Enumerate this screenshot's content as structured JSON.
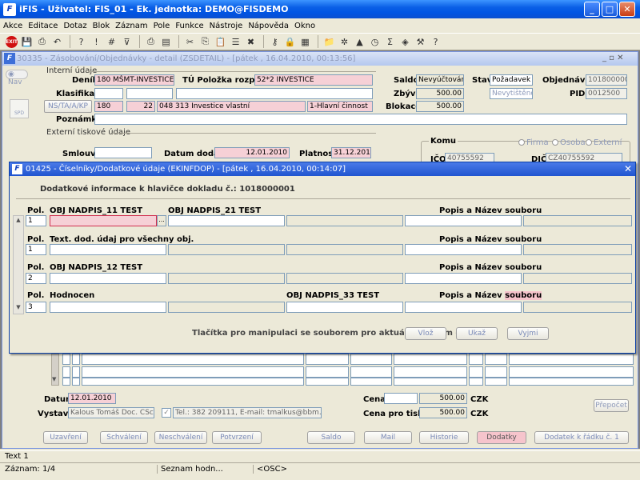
{
  "app": {
    "title": "iFIS - Uživatel: FIS_01 - Ek. jednotka: DEMO@FISDEMO",
    "logo": "F"
  },
  "menu": [
    "Akce",
    "Editace",
    "Dotaz",
    "Blok",
    "Záznam",
    "Pole",
    "Funkce",
    "Nástroje",
    "Nápověda",
    "Okno"
  ],
  "toolbar": {
    "exit_label": "EXIT"
  },
  "child": {
    "title": "30335 - Zásobování/Objednávky - detail (ZSDETAIL) - [pátek , 16.04.2010, 00:13:56]"
  },
  "nav": {
    "label": "Nav",
    "spd": "SPD"
  },
  "sections": {
    "internal": "Interní údaje",
    "external": "Externí tiskové údaje"
  },
  "form": {
    "denik_label": "Deník",
    "denik_value": "180 MŠMT-INVESTICE",
    "tu_label": "TÚ Položka rozpočtu",
    "tu_value": "52*2 INVESTICE",
    "klasifikace_label": "Klasifikace",
    "ns_label": "NS/TA/A/KP",
    "ns_v1": "180",
    "ns_v2": "22",
    "ns_v3": "048 313 Investice vlastní",
    "ns_v4": "1-Hlavní činnost",
    "poznamka_label": "Poznámka",
    "saldo_label": "Saldo",
    "saldo_value": "Nevyúčtováno",
    "zbyva_label": "Zbývá",
    "zbyva_value": "500.00",
    "blokace_label": "Blokace",
    "blokace_value": "500.00",
    "stav_label": "Stav",
    "stav_value": "Požadavek",
    "stav_value2": "Nevytištěno",
    "obj_label": "Objednávka",
    "obj_value": "1018000001",
    "pid_label": "PID",
    "pid_value": "0012500",
    "smlouva_label": "Smlouva",
    "datum_dodani_label": "Datum dodání",
    "datum_dodani_value": "12.01.2010",
    "platnost_label": "Platnost",
    "platnost_value": "31.12.2010",
    "komu_label": "Komu",
    "radio_firma": "Firma",
    "radio_osoba": "Osoba",
    "radio_externi": "Externí",
    "ico_label": "IČO",
    "ico_value": "40755592",
    "dic_label": "DIČ",
    "dic_value": "CZ40755592"
  },
  "dialog": {
    "title": "01425 - Číselníky/Dodatkové údaje (EKINFDOP) - [pátek , 16.04.2010, 00:14:07]",
    "header": "Dodatkové informace k hlavičce dokladu č.: 1018000001",
    "pol_label": "Pol.",
    "popis_label": "Popis a Název souboru",
    "popis_part1": "Popis a Název",
    "popis_part2": "souboru",
    "rows": [
      {
        "num": "1",
        "label1": "OBJ NADPIS_11 TEST",
        "label2": "OBJ NADPIS_21 TEST"
      },
      {
        "num": "1",
        "label1": "Text. dod. údaj pro všechny obj.",
        "label2": ""
      },
      {
        "num": "2",
        "label1": "OBJ NADPIS_12 TEST",
        "label2": ""
      },
      {
        "num": "3",
        "label1": "Hodnocen",
        "label2": "OBJ NADPIS_33 TEST"
      }
    ],
    "footer_text": "Tlačítka pro manipulaci se souborem pro aktuální záznam -->",
    "btn_vloz": "Vlož",
    "btn_ukaz": "Ukaž",
    "btn_vyjmi": "Vyjmi",
    "ellipsis": "..."
  },
  "bottom": {
    "datum_label": "Datum",
    "datum_value": "12.01.2010",
    "vystavil_label": "Vystavil",
    "vystavil_value": "Kalous Tomáš Doc. CSc.",
    "tel_value": "Tel.: 382 209111, E-mail: tmalkus@bbm.cz",
    "cena_label": "Cena",
    "cena_value": "500.00",
    "cena_currency": "CZK",
    "cena_tisk_label": "Cena pro tisk",
    "cena_tisk_value": "500.00",
    "cena_tisk_currency": "CZK",
    "prepocet": "Přepočet"
  },
  "buttons": [
    "Uzavření",
    "Schválení",
    "Neschválení",
    "Potvrzení",
    "Saldo",
    "Mail",
    "Historie",
    "Dodatky",
    "Dodatek k řádku č. 1"
  ],
  "status": {
    "line1": "Text 1",
    "record": "Záznam: 1/4",
    "list": "Seznam hodn...",
    "osc": "<OSC>"
  }
}
